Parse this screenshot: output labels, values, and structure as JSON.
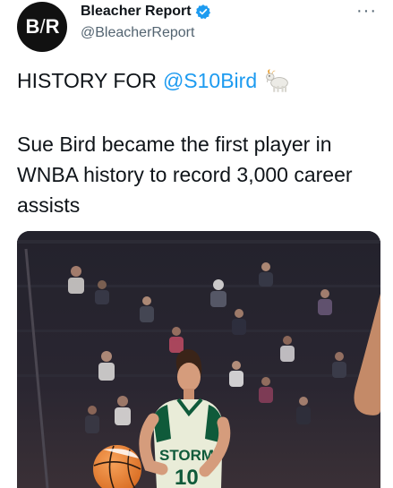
{
  "account": {
    "display_name": "Bleacher Report",
    "handle": "@BleacherReport",
    "avatar_text_left": "B",
    "avatar_text_slash": "/",
    "avatar_text_right": "R",
    "verified_color": "#1d9bf0"
  },
  "menu": {
    "more_label": "···"
  },
  "tweet": {
    "headline_prefix": "HISTORY FOR",
    "mention": "@S10Bird",
    "emoji_icon": "goat-icon",
    "body": "Sue Bird became the first player in WNBA history to record 3,000 career assists"
  },
  "media": {
    "jersey_text": "STORM",
    "jersey_number": "10"
  },
  "colors": {
    "text": "#0f1419",
    "secondary": "#536471",
    "link": "#1d9bf0"
  }
}
